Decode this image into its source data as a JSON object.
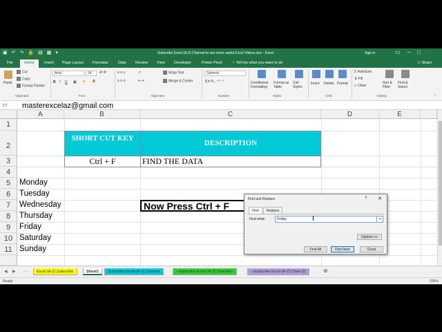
{
  "titlebar": {
    "title": "Subscribe Excel (A-Z) Channel to see more useful Excel Videos.xlsx  -  Excel",
    "sign_in": "Sign in"
  },
  "ribbon_tabs": [
    "File",
    "Home",
    "Insert",
    "Page Layout",
    "Formulas",
    "Data",
    "Review",
    "View",
    "Developer",
    "Power Pivot"
  ],
  "active_tab": "Home",
  "tell_me": "Tell me what you want to do",
  "share": "Share",
  "ribbon": {
    "clipboard": {
      "label": "Clipboard",
      "paste": "Paste",
      "cut": "Cut",
      "copy": "Copy",
      "format_painter": "Format Painter"
    },
    "font": {
      "label": "Font",
      "family": "Arial",
      "size": "14"
    },
    "alignment": {
      "label": "Alignment",
      "wrap": "Wrap Text",
      "merge": "Merge & Center"
    },
    "number": {
      "label": "Number",
      "format": "General"
    },
    "styles": {
      "label": "Styles",
      "conditional": "Conditional Formatting",
      "format_table": "Format as Table",
      "cell_styles": "Cell Styles"
    },
    "cells": {
      "label": "Cells",
      "insert": "Insert",
      "delete": "Delete",
      "format": "Format"
    },
    "editing": {
      "label": "Editing",
      "autosum": "AutoSum",
      "fill": "Fill",
      "clear": "Clear",
      "sort": "Sort & Filter",
      "find": "Find & Select"
    }
  },
  "formula_bar": {
    "name_box": "C7",
    "content": "masterexcelaz@gmail.com"
  },
  "columns": [
    "A",
    "B",
    "C",
    "D",
    "E"
  ],
  "rows": [
    "1",
    "2",
    "3",
    "4",
    "5",
    "6",
    "7",
    "8",
    "9",
    "10",
    "11"
  ],
  "table": {
    "header_b": "SHORT CUT KEY",
    "header_c": "DESCRIPTION",
    "key": "Ctrl + F",
    "desc": "FIND THE DATA"
  },
  "days": [
    "Monday",
    "Tuesday",
    "Wednesday",
    "Thursday",
    "Friday",
    "Saturday",
    "Sunday"
  ],
  "instruction": "Now Press Ctrl + F",
  "sheet_tabs": [
    {
      "label": "Excel (A-Z) Subscribe",
      "color": "#ffff00"
    },
    {
      "label": "Sheet1",
      "color": "#ffffff"
    },
    {
      "label": "Subscribe Excel (A-Z) Channel",
      "color": "#00c9d8"
    },
    {
      "label": "--Subscribe Excel (A-Z) Channel--",
      "color": "#33cc33"
    },
    {
      "label": "--Subscribe Excel (A-Z) Chan (2)",
      "color": "#b39ddb"
    }
  ],
  "status": {
    "ready": "Ready",
    "zoom": "200%"
  },
  "dialog": {
    "title": "Find and Replace",
    "help": "?",
    "tab_find": "Find",
    "tab_replace": "Replace",
    "find_what_label": "Find what:",
    "find_what_value": "Friday",
    "options": "Options >>",
    "find_all": "Find All",
    "find_next": "Find Next",
    "close": "Close"
  }
}
